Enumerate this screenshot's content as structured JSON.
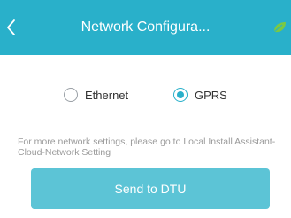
{
  "header": {
    "title": "Network Configura...",
    "back_icon": "chevron-left-icon",
    "right_icon": "leaf-icon",
    "background": "#29b0ca",
    "leaf_color": "#7ac943"
  },
  "options": {
    "items": [
      {
        "label": "Ethernet",
        "selected": false
      },
      {
        "label": "GPRS",
        "selected": true
      }
    ],
    "accent": "#29b0ca"
  },
  "note": {
    "text": "For more network settings, please go to Local Install Assistant-Cloud-Network Setting"
  },
  "actions": {
    "send_label": "Send to DTU",
    "send_color": "#5cc4d6"
  }
}
